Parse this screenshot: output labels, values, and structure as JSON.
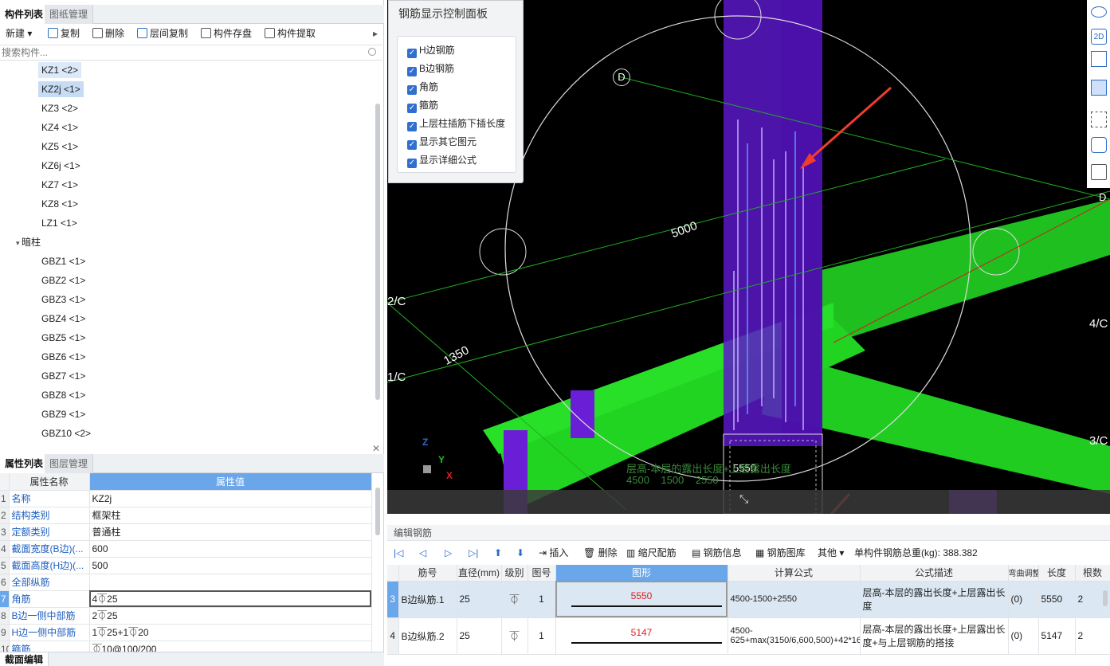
{
  "left_panel": {
    "tabs": [
      "构件列表",
      "图纸管理"
    ],
    "toolbar": {
      "new_label": "新建",
      "copy_label": "复制",
      "delete_label": "删除",
      "floor_copy_label": "层间复制",
      "save_label": "构件存盘",
      "extract_label": "构件提取"
    },
    "search_placeholder": "搜索构件...",
    "tree_items": [
      "KZ1 <2>",
      "KZ2j <1>",
      "KZ3 <2>",
      "KZ4 <1>",
      "KZ5 <1>",
      "KZ6j <1>",
      "KZ7 <1>",
      "KZ8 <1>",
      "LZ1 <1>"
    ],
    "group_label": "暗柱",
    "group_items": [
      "GBZ1 <1>",
      "GBZ2 <1>",
      "GBZ3 <1>",
      "GBZ4 <1>",
      "GBZ5 <1>",
      "GBZ6 <1>",
      "GBZ7 <1>",
      "GBZ8 <1>",
      "GBZ9 <1>",
      "GBZ10 <2>"
    ]
  },
  "property_panel": {
    "tabs": [
      "属性列表",
      "图层管理"
    ],
    "col_name": "属性名称",
    "col_value": "属性值",
    "rows": [
      {
        "num": "1",
        "name": "名称",
        "value": "KZ2j"
      },
      {
        "num": "2",
        "name": "结构类别",
        "value": "框架柱"
      },
      {
        "num": "3",
        "name": "定额类别",
        "value": "普通柱"
      },
      {
        "num": "4",
        "name": "截面宽度(B边)(...",
        "value": "600"
      },
      {
        "num": "5",
        "name": "截面高度(H边)(...",
        "value": "500"
      },
      {
        "num": "6",
        "name": "全部纵筋",
        "value": ""
      },
      {
        "num": "7",
        "name": "角筋",
        "value": "4⏁25"
      },
      {
        "num": "8",
        "name": "B边一侧中部筋",
        "value": "2⏁25"
      },
      {
        "num": "9",
        "name": "H边一侧中部筋",
        "value": "1⏁25+1⏁20"
      },
      {
        "num": "10",
        "name": "箍筋",
        "value": "⏁10@100/200"
      }
    ],
    "bottom_tab": "截面编辑"
  },
  "control_panel": {
    "title": "钢筋显示控制面板",
    "checkboxes": [
      "H边钢筋",
      "B边钢筋",
      "角筋",
      "箍筋",
      "上层柱插筋下插长度",
      "显示其它图元",
      "显示详细公式"
    ]
  },
  "viewport": {
    "axis_labels": [
      "D",
      "2/C",
      "1/C",
      "4/C",
      "3/C",
      "D"
    ],
    "dims": [
      "5000",
      "1350",
      "5550"
    ],
    "overlay_text_1": "层高-本层的露出长度+上层露出长度",
    "overlay_text_2": "4500    1500    2550",
    "axes": {
      "x": "X",
      "y": "Y",
      "z": "Z"
    },
    "view_tools": [
      "2D"
    ]
  },
  "edit_panel": {
    "title": "编辑钢筋",
    "buttons": {
      "insert": "插入",
      "delete": "删除",
      "scale": "缩尺配筋",
      "info": "钢筋信息",
      "library": "钢筋图库",
      "other": "其他"
    },
    "total_weight": "单构件钢筋总重(kg): 388.382",
    "columns": [
      "筋号",
      "直径(mm)",
      "级别",
      "图号",
      "图形",
      "计算公式",
      "公式描述",
      "弯曲调整",
      "长度",
      "根数"
    ],
    "rows": [
      {
        "num": "3",
        "name": "B边纵筋.1",
        "dia": "25",
        "grade": "⏁",
        "fig": "1",
        "shape": "5550",
        "formula": "4500-1500+2550",
        "desc": "层高-本层的露出长度+上层露出长度",
        "bend": "(0)",
        "length": "5550",
        "count": "2"
      },
      {
        "num": "4",
        "name": "B边纵筋.2",
        "dia": "25",
        "grade": "⏁",
        "fig": "1",
        "shape": "5147",
        "formula": "4500-625+max(3150/6,600,500)+42*16",
        "desc": "层高-本层的露出长度+上层露出长度+与上层钢筋的搭接",
        "bend": "(0)",
        "length": "5147",
        "count": "2"
      }
    ]
  },
  "colors": {
    "accent": "#2f6fd0",
    "header_highlight": "#6aa6ea",
    "beam": "#22c922",
    "column": "#6a1fd6"
  }
}
